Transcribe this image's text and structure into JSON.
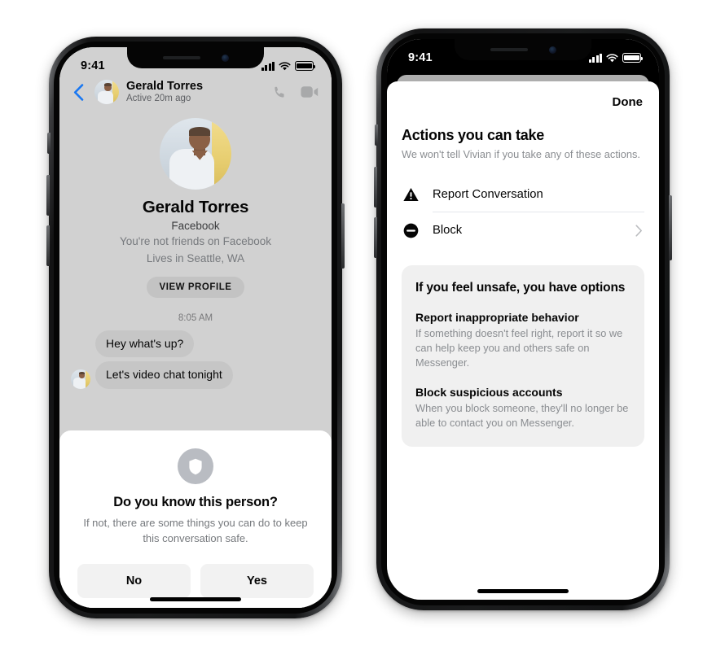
{
  "left_phone": {
    "status_bar": {
      "time": "9:41",
      "signal_icon": "cellular-bars-icon",
      "wifi_icon": "wifi-icon",
      "battery_icon": "battery-full-icon"
    },
    "header": {
      "back_icon": "back-chevron-icon",
      "contact_name": "Gerald Torres",
      "contact_status": "Active 20m ago",
      "call_icon": "phone-call-icon",
      "video_icon": "video-camera-icon"
    },
    "profile": {
      "name": "Gerald Torres",
      "source": "Facebook",
      "friend_status": "You're not friends on Facebook",
      "location": "Lives in Seattle, WA",
      "view_profile_label": "VIEW PROFILE"
    },
    "conversation": {
      "timestamp": "8:05 AM",
      "messages": [
        {
          "text": "Hey what's up?",
          "show_avatar": false
        },
        {
          "text": "Let's video chat tonight",
          "show_avatar": true
        }
      ]
    },
    "know_card": {
      "shield_icon": "shield-icon",
      "title": "Do you know this person?",
      "subtitle": "If not, there are some things you can do to keep this conversation safe.",
      "no_label": "No",
      "yes_label": "Yes"
    }
  },
  "right_phone": {
    "status_bar": {
      "time": "9:41",
      "signal_icon": "cellular-bars-icon",
      "wifi_icon": "wifi-icon",
      "battery_icon": "battery-full-icon"
    },
    "sheet": {
      "done_label": "Done",
      "section_title": "Actions you can take",
      "section_subtitle": "We won't tell Vivian if you take any of these actions.",
      "actions": [
        {
          "label": "Report Conversation",
          "icon": "warning-triangle-icon",
          "has_chevron": false
        },
        {
          "label": "Block",
          "icon": "block-circle-icon",
          "has_chevron": true,
          "chevron_icon": "chevron-right-icon"
        }
      ],
      "info_card": {
        "title": "If you feel unsafe, you have options",
        "items": [
          {
            "heading": "Report inappropriate behavior",
            "body": "If something doesn't feel right, report it so we can help keep you and others safe on Messenger."
          },
          {
            "heading": "Block suspicious accounts",
            "body": "When you block someone, they'll no longer be able to contact you on Messenger."
          }
        ]
      }
    }
  },
  "colors": {
    "page_bg": "#ffffff",
    "chat_bg": "#d1d1d1",
    "bubble_bg": "#c6c6c6",
    "accent_blue": "#1877f2",
    "card_bg": "#f0f0f0",
    "muted_text": "#8a8d91"
  }
}
